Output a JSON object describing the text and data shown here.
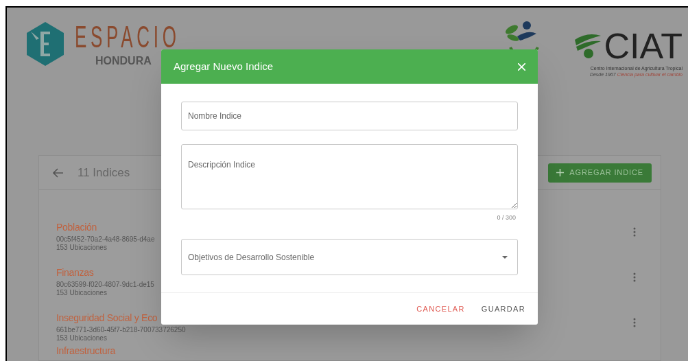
{
  "logos": {
    "espacio": {
      "word": "ESPACIO",
      "subtitle": "HONDURA"
    },
    "ciat": {
      "name": "CIAT",
      "tagline": "Centro Internacional de Agricultura Tropical",
      "since": "Desde 1967",
      "motto": "Ciencia para cultivar el cambio"
    }
  },
  "panel": {
    "title": "11 Indices",
    "add_button": "AGREGAR INDICE",
    "items": [
      {
        "name": "Población",
        "id": "00c5f452-70a2-4a48-8695-d4ae",
        "count": "153 Ubicaciones"
      },
      {
        "name": "Finanzas",
        "id": "80c63599-f020-4807-9dc1-de15",
        "count": "153 Ubicaciones"
      },
      {
        "name": "Inseguridad Social y Eco",
        "id": "661be771-3d60-45f7-b218-700733726250",
        "count": "153 Ubicaciones"
      },
      {
        "name": "Infraestructura"
      }
    ]
  },
  "dialog": {
    "title": "Agregar Nuevo Indice",
    "fields": [
      {
        "kind": "text",
        "placeholder": "Nombre Indice"
      },
      {
        "kind": "textarea",
        "placeholder": "Descripción Indice",
        "counter": "0 / 300"
      },
      {
        "kind": "select",
        "placeholder": "Objetivos de Desarrollo Sostenible"
      }
    ],
    "buttons": [
      {
        "label": "CANCELAR",
        "kind": "cancel"
      },
      {
        "label": "GUARDAR",
        "kind": "save"
      }
    ]
  }
}
